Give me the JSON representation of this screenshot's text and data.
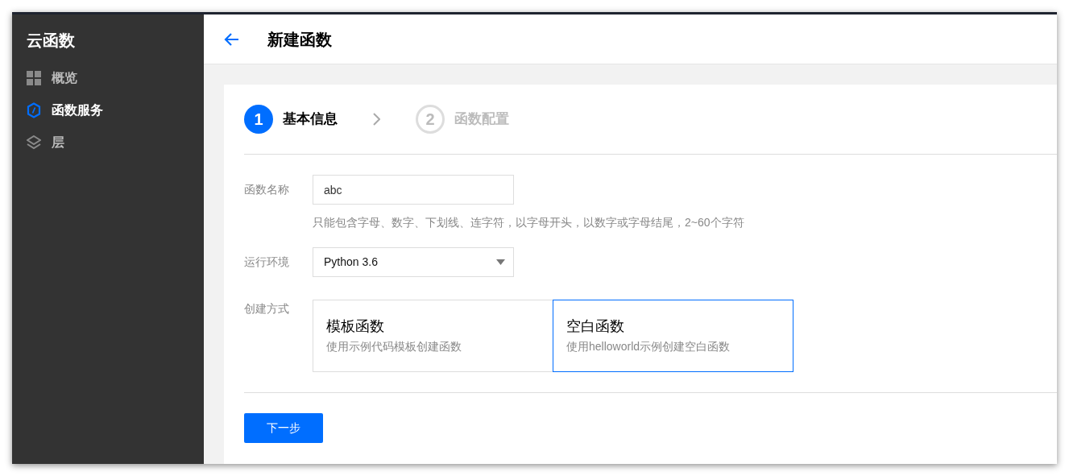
{
  "sidebar": {
    "title": "云函数",
    "items": [
      {
        "label": "概览",
        "selected": false
      },
      {
        "label": "函数服务",
        "selected": true
      },
      {
        "label": "层",
        "selected": false
      }
    ]
  },
  "header": {
    "title": "新建函数"
  },
  "steps": [
    {
      "number": "1",
      "label": "基本信息",
      "selected": true
    },
    {
      "number": "2",
      "label": "函数配置",
      "selected": false
    }
  ],
  "form": {
    "name": {
      "label": "函数名称",
      "value": "abc",
      "hint": "只能包含字母、数字、下划线、连字符，以字母开头，以数字或字母结尾，2~60个字符"
    },
    "runtime": {
      "label": "运行环境",
      "value": "Python 3.6"
    },
    "method": {
      "label": "创建方式",
      "options": [
        {
          "title": "模板函数",
          "description": "使用示例代码模板创建函数",
          "selected": false
        },
        {
          "title": "空白函数",
          "description": "使用helloworld示例创建空白函数",
          "selected": true
        }
      ]
    }
  },
  "next_button": "下一步"
}
